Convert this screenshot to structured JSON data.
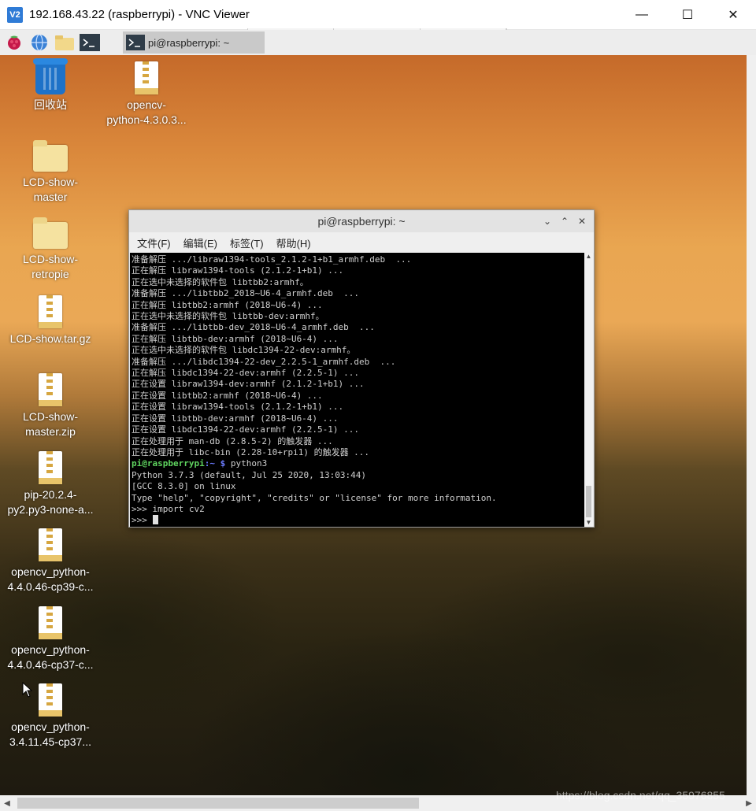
{
  "window": {
    "title": "192.168.43.22 (raspberrypi) - VNC Viewer",
    "app_icon_text": "V2",
    "controls": {
      "minimize": "—",
      "maximize": "☐",
      "close": "✕"
    }
  },
  "panel": {
    "icons": [
      "raspberry-icon",
      "globe-icon",
      "folder-icon",
      "terminal-icon"
    ],
    "task": {
      "label": "pi@raspberrypi: ~"
    }
  },
  "desktop": {
    "icons": [
      {
        "label": "回收站",
        "type": "trash"
      },
      {
        "label": "opencv-\npython-4.3.0.3...",
        "type": "archive"
      },
      {
        "label": "LCD-show-\nmaster",
        "type": "folder"
      },
      {
        "label": "LCD-show-\nretropie",
        "type": "folder"
      },
      {
        "label": "LCD-show.tar.gz",
        "type": "archive"
      },
      {
        "label": "LCD-show-\nmaster.zip",
        "type": "archive"
      },
      {
        "label": "pip-20.2.4-\npy2.py3-none-a...",
        "type": "archive"
      },
      {
        "label": "opencv_python-\n4.4.0.46-cp39-c...",
        "type": "archive"
      },
      {
        "label": "opencv_python-\n4.4.0.46-cp37-c...",
        "type": "archive"
      },
      {
        "label": "opencv_python-\n3.4.11.45-cp37...",
        "type": "archive"
      }
    ]
  },
  "terminal": {
    "title": "pi@raspberrypi: ~",
    "controls": {
      "minimize": "⌄",
      "maximize": "⌃",
      "close": "✕"
    },
    "menu": [
      "文件(F)",
      "编辑(E)",
      "标签(T)",
      "帮助(H)"
    ],
    "lines": [
      "准备解压 .../libraw1394-tools_2.1.2-1+b1_armhf.deb  ...",
      "正在解压 libraw1394-tools (2.1.2-1+b1) ...",
      "正在选中未选择的软件包 libtbb2:armhf。",
      "准备解压 .../libtbb2_2018~U6-4_armhf.deb  ...",
      "正在解压 libtbb2:armhf (2018~U6-4) ...",
      "正在选中未选择的软件包 libtbb-dev:armhf。",
      "准备解压 .../libtbb-dev_2018~U6-4_armhf.deb  ...",
      "正在解压 libtbb-dev:armhf (2018~U6-4) ...",
      "正在选中未选择的软件包 libdc1394-22-dev:armhf。",
      "准备解压 .../libdc1394-22-dev_2.2.5-1_armhf.deb  ...",
      "正在解压 libdc1394-22-dev:armhf (2.2.5-1) ...",
      "正在设置 libraw1394-dev:armhf (2.1.2-1+b1) ...",
      "正在设置 libtbb2:armhf (2018~U6-4) ...",
      "正在设置 libraw1394-tools (2.1.2-1+b1) ...",
      "正在设置 libtbb-dev:armhf (2018~U6-4) ...",
      "正在设置 libdc1394-22-dev:armhf (2.2.5-1) ...",
      "正在处理用于 man-db (2.8.5-2) 的触发器 ...",
      "正在处理用于 libc-bin (2.28-10+rpi1) 的触发器 ..."
    ],
    "prompt": {
      "user": "pi@raspberrypi",
      "path": ":~ $",
      "command": " python3"
    },
    "python_lines": [
      "Python 3.7.3 (default, Jul 25 2020, 13:03:44)",
      "[GCC 8.3.0] on linux",
      "Type \"help\", \"copyright\", \"credits\" or \"license\" for more information.",
      ">>> import cv2"
    ],
    "current_prompt": ">>> "
  },
  "watermark": "https://blog.csdn.net/qq_35976855"
}
